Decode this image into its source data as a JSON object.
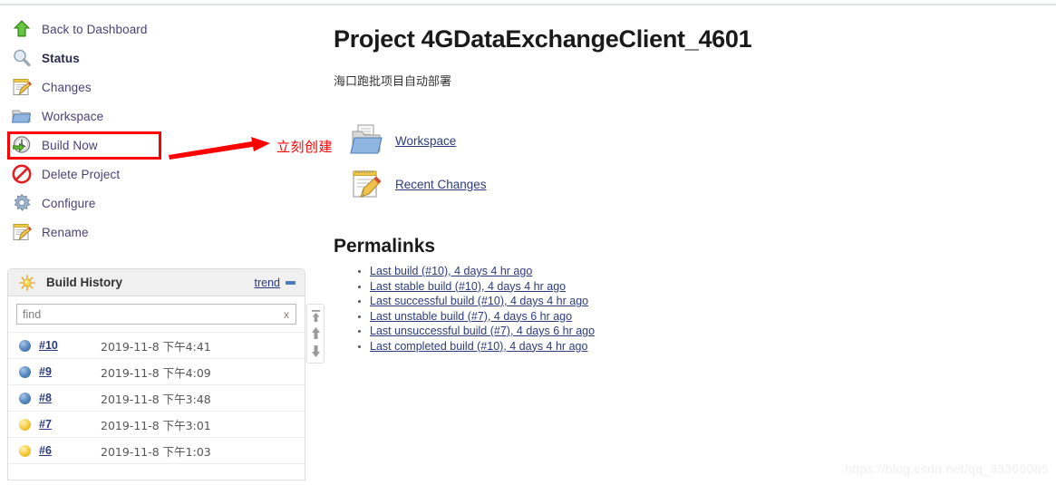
{
  "sidebar": {
    "tasks": [
      {
        "label": "Back to Dashboard",
        "icon": "up-arrow-icon",
        "bold": false
      },
      {
        "label": "Status",
        "icon": "magnifier-icon",
        "bold": true
      },
      {
        "label": "Changes",
        "icon": "notepad-pencil-icon",
        "bold": false
      },
      {
        "label": "Workspace",
        "icon": "folder-icon",
        "bold": false
      },
      {
        "label": "Build Now",
        "icon": "clock-play-icon",
        "bold": false
      },
      {
        "label": "Delete Project",
        "icon": "no-entry-icon",
        "bold": false
      },
      {
        "label": "Configure",
        "icon": "gear-icon",
        "bold": false
      },
      {
        "label": "Rename",
        "icon": "notepad-pencil-icon",
        "bold": false
      }
    ]
  },
  "annotation": {
    "text": "立刻创建",
    "color": "#ff0000",
    "highlight_target": "Build Now"
  },
  "build_history": {
    "title": "Build History",
    "header_icon": "weather-sun-icon",
    "trend_label": "trend",
    "collapse_icon": "minus-icon",
    "find_placeholder": "find",
    "find_value": "",
    "clear_label": "x",
    "scroll_controls": [
      "jump-to-top-icon",
      "scroll-up-icon",
      "scroll-down-icon"
    ],
    "rows": [
      {
        "number": "#10",
        "date": "2019-11-8 下午4:41",
        "status": "blue"
      },
      {
        "number": "#9",
        "date": "2019-11-8 下午4:09",
        "status": "blue"
      },
      {
        "number": "#8",
        "date": "2019-11-8 下午3:48",
        "status": "blue"
      },
      {
        "number": "#7",
        "date": "2019-11-8 下午3:01",
        "status": "yellow"
      },
      {
        "number": "#6",
        "date": "2019-11-8 下午1:03",
        "status": "yellow"
      }
    ]
  },
  "main": {
    "title": "Project 4GDataExchangeClient_4601",
    "description": "海口跑批项目自动部署",
    "links": [
      {
        "label": "Workspace",
        "icon": "folder-docs-icon"
      },
      {
        "label": "Recent Changes",
        "icon": "notepad-pencil-icon"
      }
    ],
    "permalinks_heading": "Permalinks",
    "permalinks": [
      "Last build (#10), 4 days 4 hr ago",
      "Last stable build (#10), 4 days 4 hr ago",
      "Last successful build (#10), 4 days 4 hr ago",
      "Last unstable build (#7), 4 days 6 hr ago",
      "Last unsuccessful build (#7), 4 days 6 hr ago",
      "Last completed build (#10), 4 days 4 hr ago"
    ]
  },
  "watermark": "https://blog.csdn.net/qq_33369085",
  "colors": {
    "link": "#2b3b7d",
    "task_link": "#4a3f7a",
    "annotation": "#ff0000",
    "panel_header_bg": "#f0f0f0",
    "ball_success": "#2d5f96",
    "ball_unstable": "#dba50f"
  }
}
